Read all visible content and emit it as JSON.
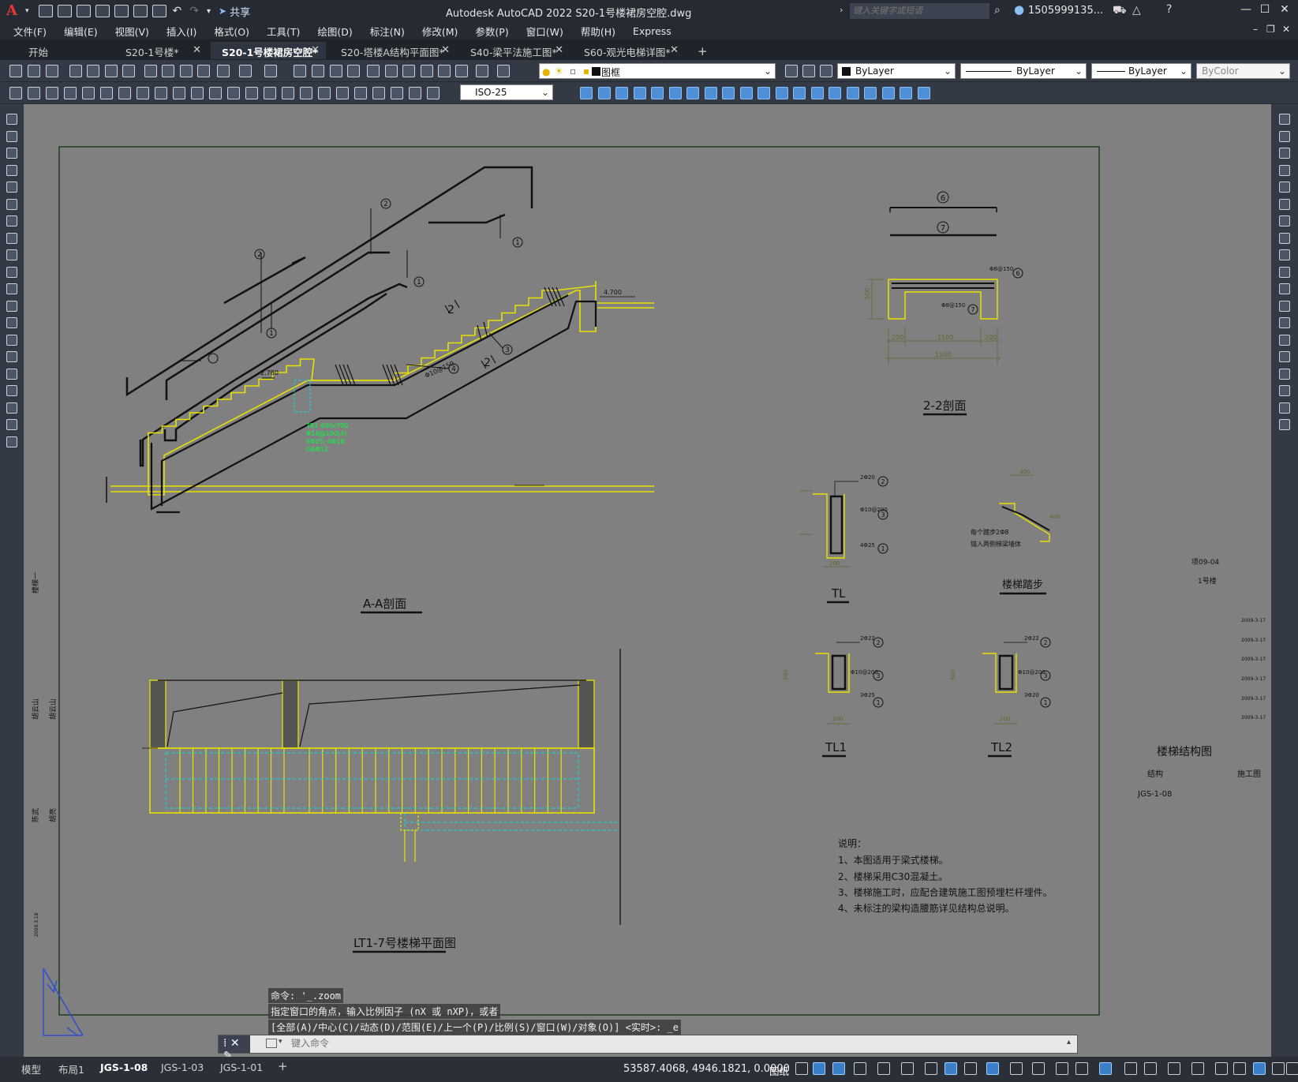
{
  "app": {
    "logo_text": "A",
    "title": "Autodesk AutoCAD 2022    S20-1号楼裙房空腔.dwg",
    "share_label": "共享",
    "search_placeholder": "键入关键字或短语",
    "user": "1505999135...",
    "window_controls": [
      "minimize-icon",
      "maximize-icon",
      "close-icon"
    ]
  },
  "menu": [
    "文件(F)",
    "编辑(E)",
    "视图(V)",
    "插入(I)",
    "格式(O)",
    "工具(T)",
    "绘图(D)",
    "标注(N)",
    "修改(M)",
    "参数(P)",
    "窗口(W)",
    "帮助(H)",
    "Express"
  ],
  "file_tabs": [
    {
      "label": "开始",
      "active": false,
      "closable": false
    },
    {
      "label": "S20-1号楼*",
      "active": false,
      "closable": true
    },
    {
      "label": "S20-1号楼裙房空腔*",
      "active": true,
      "closable": true
    },
    {
      "label": "S20-塔楼A结构平面图*",
      "active": false,
      "closable": true
    },
    {
      "label": "S40-梁平法施工图*",
      "active": false,
      "closable": true
    },
    {
      "label": "S60-观光电梯详图*",
      "active": false,
      "closable": true
    }
  ],
  "new_tab_label": "+",
  "properties": {
    "layer": "图框",
    "color": "ByLayer",
    "linetype": "ByLayer",
    "lineweight": "ByLayer",
    "plotstyle": "ByColor",
    "dimstyle": "ISO-25"
  },
  "drawing": {
    "texts": {
      "section_aa": "A-A剖面",
      "section_22": "2-2剖面",
      "plan_title": "LT1-7号楼梯平面图",
      "tl": "TL",
      "tl1": "TL1",
      "tl2": "TL2",
      "step_detail": "楼梯踏步",
      "elev_top": "4.700",
      "elev_mid": "2.780",
      "mark_1": "1",
      "mark_2": "2",
      "mark_3": "3",
      "mark_4": "4",
      "mark_6": "6",
      "mark_7": "7",
      "rebar_4": "Φ10@150",
      "rebar_6": "Φ8@150",
      "rebar_7": "Φ8@150",
      "dim_200": "200",
      "dim_1100": "1100",
      "dim_1500": "1500",
      "dim_300": "300",
      "dim_400": "400",
      "dim_500": "500",
      "tl_top": "2Φ20",
      "tl_stir": "Φ10@200",
      "tl_bot": "4Φ25",
      "tl1_top": "2Φ22",
      "tl1_bot": "3Φ25",
      "tl2_top": "2Φ22",
      "tl2_bot": "3Φ20",
      "step_note1": "每个踏步2Φ8",
      "step_note2": "锚入两侧梯梁墙体",
      "green_1": "TB1 400x700",
      "green_2": "Φ10@100(4)",
      "green_3": "6Φ25; 4Φ18",
      "green_4": "G6Φ12",
      "notes_title": "说明：",
      "notes": [
        "1、本图适用于梁式楼梯。",
        "2、楼梯采用C30混凝土。",
        "3、楼梯施工时，应配合建筑施工图预埋栏杆埋件。",
        "4、未标注的梁构造腰筋详见结构总说明。"
      ],
      "tb_project": "项09-04",
      "tb_bldg": "1号楼",
      "tb_dates": [
        "2009-3-17",
        "2009-3-17",
        "2009-3-17",
        "2009-3-17",
        "2009-3-17",
        "2009-3-17"
      ],
      "tb_name": "楼梯结构图",
      "tb_disc": "结构",
      "tb_stage": "施工图",
      "tb_no": "JGS-1-08",
      "side_a": "楼梯一",
      "side_b": "胡云山",
      "side_c": "胡云山",
      "side_d": "陈武",
      "side_e": "胡亮",
      "side_f": "2009.3.18"
    }
  },
  "command": {
    "history": [
      "命令: '_.zoom",
      "指定窗口的角点，输入比例因子 (nX 或 nXP)，或者",
      "[全部(A)/中心(C)/动态(D)/范围(E)/上一个(P)/比例(S)/窗口(W)/对象(O)] <实时>: _e"
    ],
    "placeholder": "键入命令"
  },
  "layouts": [
    "模型",
    "布局1",
    "JGS-1-08",
    "JGS-1-03",
    "JGS-1-01"
  ],
  "active_layout": "JGS-1-08",
  "add_layout_label": "+",
  "status": {
    "coords": "53587.4068, 4946.1821, 0.0000",
    "space": "图纸"
  }
}
